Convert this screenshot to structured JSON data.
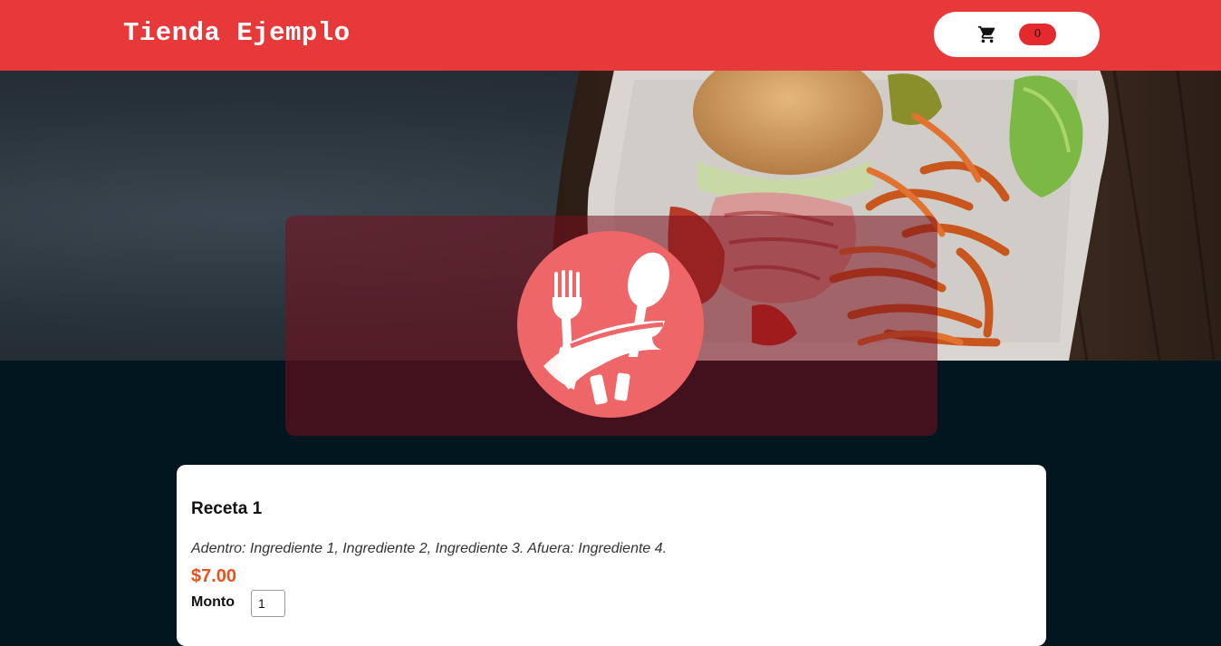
{
  "header": {
    "brand": "Tienda Ejemplo",
    "cart_icon": "shopping-cart-icon",
    "cart_count": "0"
  },
  "hero": {
    "image": "burger-and-fries-photo",
    "logo_icon": "fork-spoon-napkin-icon"
  },
  "product": {
    "title": "Receta 1",
    "description": "Adentro: Ingrediente 1, Ingrediente 2, Ingrediente 3. Afuera: Ingrediente 4.",
    "price": "$7.00",
    "quantity_label": "Monto",
    "quantity_value": "1"
  },
  "colors": {
    "header_bg": "#e8393a",
    "page_bg": "#021620",
    "price": "#e8521e",
    "badge": "#e52a2e",
    "logo_circle": "#ee6668"
  }
}
